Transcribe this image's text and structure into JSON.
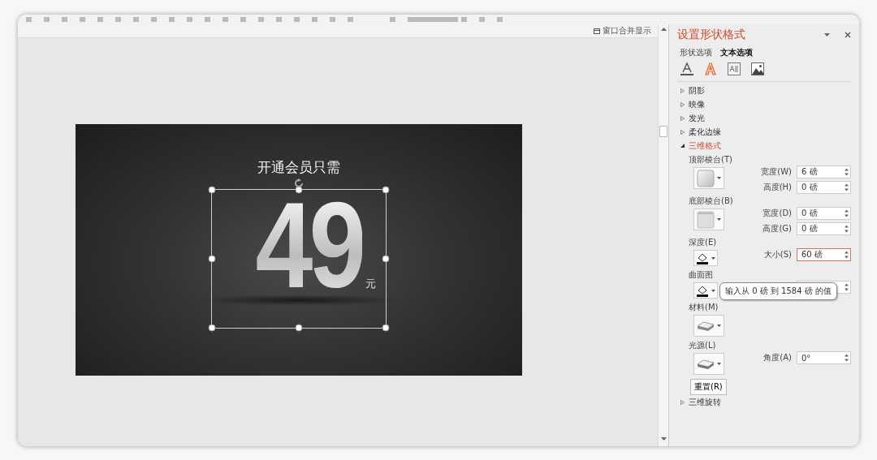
{
  "canvas": {
    "merge_button": "窗口合并显示"
  },
  "slide": {
    "subtitle": "开通会员只需",
    "price": "49",
    "unit": "元",
    "selected": true
  },
  "panel": {
    "title": "设置形状格式",
    "tabs": [
      {
        "label": "形状选项",
        "selected": false
      },
      {
        "label": "文本选项",
        "selected": true
      }
    ],
    "icon_tabs": [
      {
        "kind": "text-fill",
        "selected": false
      },
      {
        "kind": "text-effects",
        "selected": true
      },
      {
        "kind": "textbox",
        "selected": false
      },
      {
        "kind": "picture",
        "selected": false
      }
    ],
    "sections": [
      {
        "label": "阴影",
        "expanded": false
      },
      {
        "label": "映像",
        "expanded": false
      },
      {
        "label": "发光",
        "expanded": false
      },
      {
        "label": "柔化边缘",
        "expanded": false
      },
      {
        "label": "三维格式",
        "expanded": true,
        "groups": [
          {
            "label": "顶部棱台(T)",
            "picker": {
              "kind": "bevel-top"
            },
            "fields": [
              {
                "label": "宽度(W)",
                "value": "6 磅",
                "focused": false
              },
              {
                "label": "高度(H)",
                "value": "0 磅",
                "focused": false
              }
            ]
          },
          {
            "label": "底部棱台(B)",
            "picker": {
              "kind": "bevel-bottom"
            },
            "fields": [
              {
                "label": "宽度(D)",
                "value": "0 磅",
                "focused": false
              },
              {
                "label": "高度(G)",
                "value": "0 磅",
                "focused": false
              }
            ]
          },
          {
            "label": "深度(E)",
            "picker": {
              "kind": "color"
            },
            "fields": [
              {
                "label": "大小(S)",
                "value": "60 磅",
                "focused": true
              }
            ]
          },
          {
            "label": "曲面图",
            "picker": {
              "kind": "color"
            },
            "fields": [
              {
                "focused": false
              }
            ]
          },
          {
            "label": "材料(M)",
            "picker": {
              "kind": "material"
            }
          },
          {
            "label": "光源(L)",
            "picker": {
              "kind": "lighting"
            },
            "fields": [
              {
                "label": "角度(A)",
                "value": "0°",
                "focused": false
              }
            ]
          }
        ],
        "reset_button": "重置(R)"
      },
      {
        "label": "三维旋转",
        "expanded": false
      }
    ],
    "tooltip": "输入从 0 磅 到 1584 磅 的值"
  }
}
